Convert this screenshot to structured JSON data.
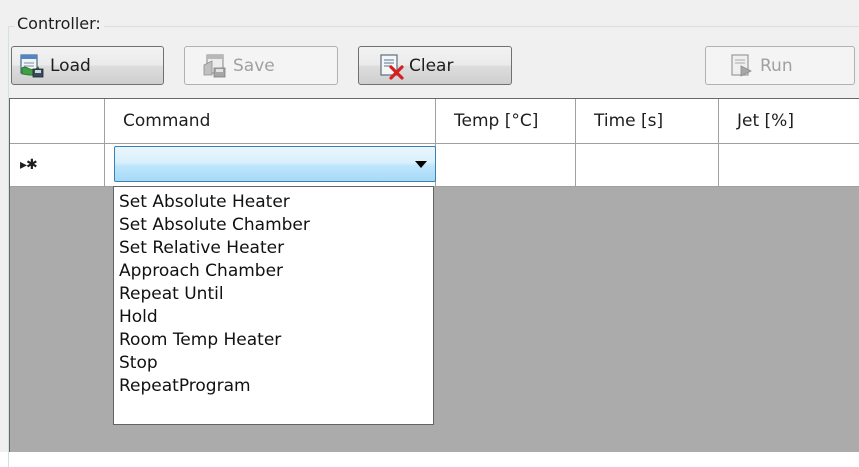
{
  "group": {
    "title": "Controller:"
  },
  "toolbar": {
    "load_label": "Load",
    "save_label": "Save",
    "clear_label": "Clear",
    "run_label": "Run",
    "icons": {
      "load": "load-icon",
      "save": "save-icon",
      "clear": "clear-icon",
      "run": "run-icon"
    },
    "enabled": {
      "load": true,
      "save": false,
      "clear": true,
      "run": false
    }
  },
  "grid": {
    "columns": [
      "",
      "Command",
      "Temp [°C]",
      "Time [s]",
      "Jet [%]"
    ],
    "new_row_marker": "▸✱",
    "rows": [
      {
        "command": "",
        "temp": "",
        "time": "",
        "jet": ""
      }
    ]
  },
  "command_dropdown": {
    "selected": "",
    "options": [
      "Set Absolute Heater",
      "Set Absolute Chamber",
      "Set Relative Heater",
      "Approach Chamber",
      "Repeat Until",
      "Hold",
      "Room Temp Heater",
      "Stop",
      "RepeatProgram"
    ]
  },
  "colors": {
    "panel_bg": "#f0f0f0",
    "grid_bg": "#ababab",
    "combo_border": "#3c7fb1",
    "combo_fill": "#bee6fd"
  }
}
